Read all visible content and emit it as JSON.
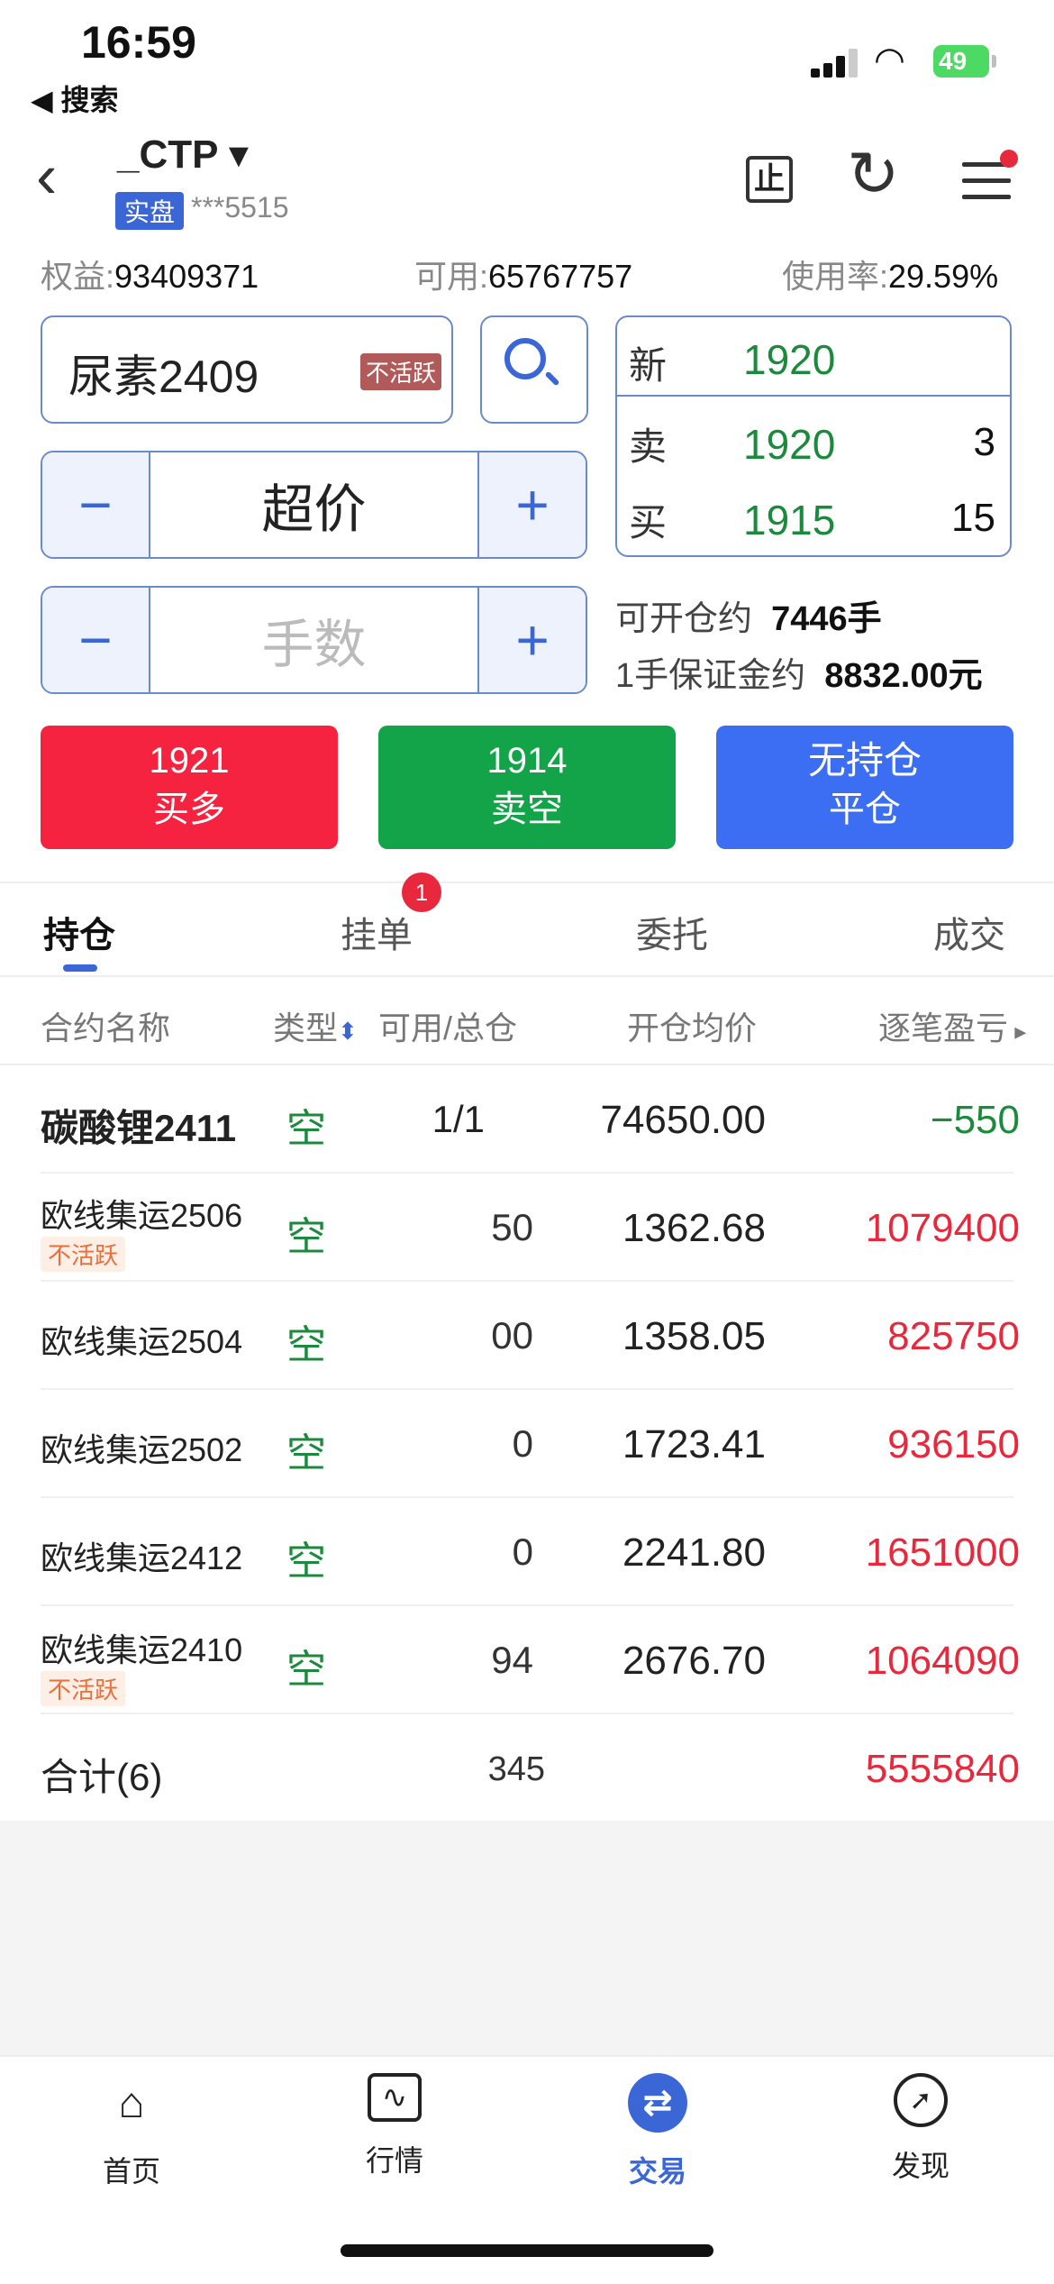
{
  "status": {
    "time": "16:59",
    "back_app": "◀ 搜索",
    "battery": "49"
  },
  "header": {
    "account_name": "_CTP ▾",
    "real_badge": "实盘",
    "account_no": "***5515",
    "icons": [
      "stop-icon",
      "refresh-icon",
      "menu-icon"
    ]
  },
  "stats": {
    "equity_label": "权益:",
    "equity": "93409371",
    "available_label": "可用:",
    "available": "65767757",
    "usage_label": "使用率:",
    "usage": "29.59%"
  },
  "order": {
    "contract": "尿素2409",
    "contract_status": "不活跃",
    "price_type": "超价",
    "qty_placeholder": "手数",
    "minus": "−",
    "plus": "+"
  },
  "quote": {
    "last_label": "新",
    "last": "1920",
    "ask_label": "卖",
    "ask": "1920",
    "ask_vol": "3",
    "bid_label": "买",
    "bid": "1915",
    "bid_vol": "15"
  },
  "capacity": {
    "open_label": "可开仓约",
    "open_value": "7446手",
    "margin_label": "1手保证金约",
    "margin_value": "8832.00元"
  },
  "actions": {
    "buy_price": "1921",
    "buy_label": "买多",
    "sell_price": "1914",
    "sell_label": "卖空",
    "close_top": "无持仓",
    "close_label": "平仓",
    "colors": {
      "buy": "#f5233f",
      "sell": "#13a44a",
      "close": "#3b6ef2"
    }
  },
  "tabs": [
    {
      "label": "持仓"
    },
    {
      "label": "挂单",
      "badge": "1"
    },
    {
      "label": "委托"
    },
    {
      "label": "成交"
    }
  ],
  "table": {
    "headers": [
      "合约名称",
      "类型",
      "可用/总仓",
      "开仓均价",
      "逐笔盈亏"
    ],
    "rows": [
      {
        "name": "碳酸锂2411",
        "type": "空",
        "avail": "1/1",
        "price": "74650.00",
        "pnl": "−550"
      },
      {
        "name": "欧线集运2506",
        "tag": "不活跃",
        "type": "空",
        "avail": "50",
        "price": "1362.68",
        "pnl": "1079400"
      },
      {
        "name": "欧线集运2504",
        "type": "空",
        "avail": "00",
        "price": "1358.05",
        "pnl": "825750"
      },
      {
        "name": "欧线集运2502",
        "type": "空",
        "avail": "0",
        "price": "1723.41",
        "pnl": "936150"
      },
      {
        "name": "欧线集运2412",
        "type": "空",
        "avail": "0",
        "price": "2241.80",
        "pnl": "1651000"
      },
      {
        "name": "欧线集运2410",
        "tag": "不活跃",
        "type": "空",
        "avail": "94",
        "price": "2676.70",
        "pnl": "1064090"
      }
    ],
    "total_label": "合计(6)",
    "total_avail": "345",
    "total_pnl": "5555840"
  },
  "bottom_nav": [
    {
      "label": "首页",
      "icon": "home-icon"
    },
    {
      "label": "行情",
      "icon": "chart-icon"
    },
    {
      "label": "交易",
      "icon": "trade-icon"
    },
    {
      "label": "发现",
      "icon": "compass-icon"
    }
  ]
}
